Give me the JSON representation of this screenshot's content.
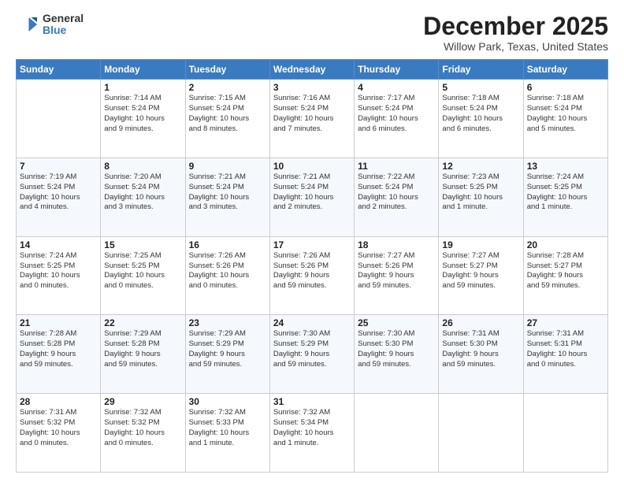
{
  "header": {
    "logo_general": "General",
    "logo_blue": "Blue",
    "month_title": "December 2025",
    "location": "Willow Park, Texas, United States"
  },
  "days_of_week": [
    "Sunday",
    "Monday",
    "Tuesday",
    "Wednesday",
    "Thursday",
    "Friday",
    "Saturday"
  ],
  "weeks": [
    [
      {
        "day": "",
        "info": ""
      },
      {
        "day": "1",
        "info": "Sunrise: 7:14 AM\nSunset: 5:24 PM\nDaylight: 10 hours\nand 9 minutes."
      },
      {
        "day": "2",
        "info": "Sunrise: 7:15 AM\nSunset: 5:24 PM\nDaylight: 10 hours\nand 8 minutes."
      },
      {
        "day": "3",
        "info": "Sunrise: 7:16 AM\nSunset: 5:24 PM\nDaylight: 10 hours\nand 7 minutes."
      },
      {
        "day": "4",
        "info": "Sunrise: 7:17 AM\nSunset: 5:24 PM\nDaylight: 10 hours\nand 6 minutes."
      },
      {
        "day": "5",
        "info": "Sunrise: 7:18 AM\nSunset: 5:24 PM\nDaylight: 10 hours\nand 6 minutes."
      },
      {
        "day": "6",
        "info": "Sunrise: 7:18 AM\nSunset: 5:24 PM\nDaylight: 10 hours\nand 5 minutes."
      }
    ],
    [
      {
        "day": "7",
        "info": "Sunrise: 7:19 AM\nSunset: 5:24 PM\nDaylight: 10 hours\nand 4 minutes."
      },
      {
        "day": "8",
        "info": "Sunrise: 7:20 AM\nSunset: 5:24 PM\nDaylight: 10 hours\nand 3 minutes."
      },
      {
        "day": "9",
        "info": "Sunrise: 7:21 AM\nSunset: 5:24 PM\nDaylight: 10 hours\nand 3 minutes."
      },
      {
        "day": "10",
        "info": "Sunrise: 7:21 AM\nSunset: 5:24 PM\nDaylight: 10 hours\nand 2 minutes."
      },
      {
        "day": "11",
        "info": "Sunrise: 7:22 AM\nSunset: 5:24 PM\nDaylight: 10 hours\nand 2 minutes."
      },
      {
        "day": "12",
        "info": "Sunrise: 7:23 AM\nSunset: 5:25 PM\nDaylight: 10 hours\nand 1 minute."
      },
      {
        "day": "13",
        "info": "Sunrise: 7:24 AM\nSunset: 5:25 PM\nDaylight: 10 hours\nand 1 minute."
      }
    ],
    [
      {
        "day": "14",
        "info": "Sunrise: 7:24 AM\nSunset: 5:25 PM\nDaylight: 10 hours\nand 0 minutes."
      },
      {
        "day": "15",
        "info": "Sunrise: 7:25 AM\nSunset: 5:25 PM\nDaylight: 10 hours\nand 0 minutes."
      },
      {
        "day": "16",
        "info": "Sunrise: 7:26 AM\nSunset: 5:26 PM\nDaylight: 10 hours\nand 0 minutes."
      },
      {
        "day": "17",
        "info": "Sunrise: 7:26 AM\nSunset: 5:26 PM\nDaylight: 9 hours\nand 59 minutes."
      },
      {
        "day": "18",
        "info": "Sunrise: 7:27 AM\nSunset: 5:26 PM\nDaylight: 9 hours\nand 59 minutes."
      },
      {
        "day": "19",
        "info": "Sunrise: 7:27 AM\nSunset: 5:27 PM\nDaylight: 9 hours\nand 59 minutes."
      },
      {
        "day": "20",
        "info": "Sunrise: 7:28 AM\nSunset: 5:27 PM\nDaylight: 9 hours\nand 59 minutes."
      }
    ],
    [
      {
        "day": "21",
        "info": "Sunrise: 7:28 AM\nSunset: 5:28 PM\nDaylight: 9 hours\nand 59 minutes."
      },
      {
        "day": "22",
        "info": "Sunrise: 7:29 AM\nSunset: 5:28 PM\nDaylight: 9 hours\nand 59 minutes."
      },
      {
        "day": "23",
        "info": "Sunrise: 7:29 AM\nSunset: 5:29 PM\nDaylight: 9 hours\nand 59 minutes."
      },
      {
        "day": "24",
        "info": "Sunrise: 7:30 AM\nSunset: 5:29 PM\nDaylight: 9 hours\nand 59 minutes."
      },
      {
        "day": "25",
        "info": "Sunrise: 7:30 AM\nSunset: 5:30 PM\nDaylight: 9 hours\nand 59 minutes."
      },
      {
        "day": "26",
        "info": "Sunrise: 7:31 AM\nSunset: 5:30 PM\nDaylight: 9 hours\nand 59 minutes."
      },
      {
        "day": "27",
        "info": "Sunrise: 7:31 AM\nSunset: 5:31 PM\nDaylight: 10 hours\nand 0 minutes."
      }
    ],
    [
      {
        "day": "28",
        "info": "Sunrise: 7:31 AM\nSunset: 5:32 PM\nDaylight: 10 hours\nand 0 minutes."
      },
      {
        "day": "29",
        "info": "Sunrise: 7:32 AM\nSunset: 5:32 PM\nDaylight: 10 hours\nand 0 minutes."
      },
      {
        "day": "30",
        "info": "Sunrise: 7:32 AM\nSunset: 5:33 PM\nDaylight: 10 hours\nand 1 minute."
      },
      {
        "day": "31",
        "info": "Sunrise: 7:32 AM\nSunset: 5:34 PM\nDaylight: 10 hours\nand 1 minute."
      },
      {
        "day": "",
        "info": ""
      },
      {
        "day": "",
        "info": ""
      },
      {
        "day": "",
        "info": ""
      }
    ]
  ]
}
